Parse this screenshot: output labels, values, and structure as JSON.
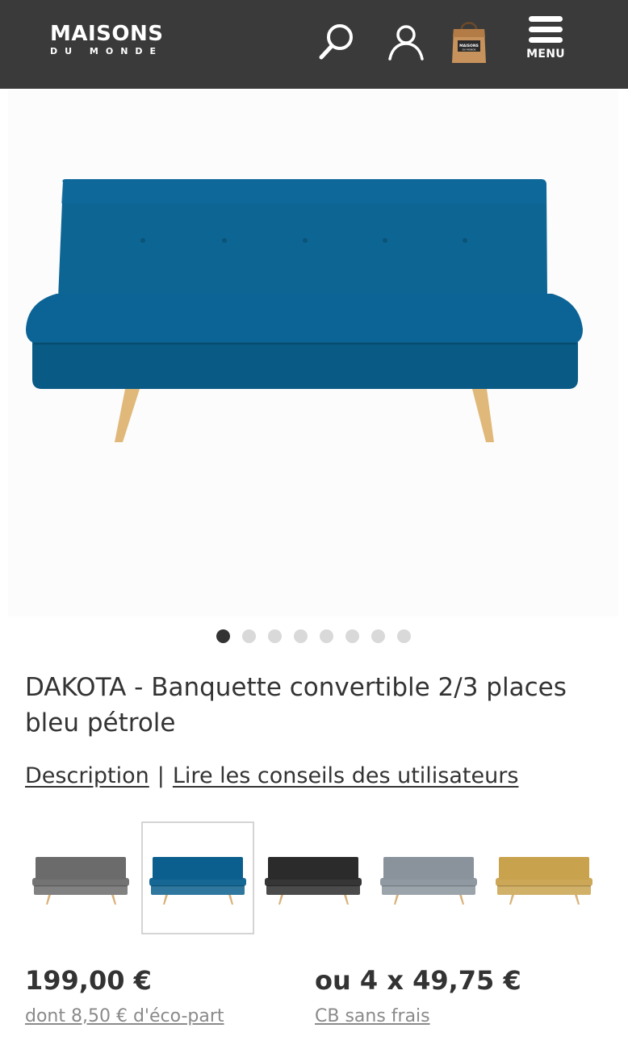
{
  "header": {
    "logo_main": "MAISONS",
    "logo_sub": "DU MONDE",
    "bag_text": "MAISONS DU MONDE",
    "menu_label": "MENU",
    "icons": [
      "search-icon",
      "user-icon",
      "shopping-bag-icon",
      "menu-icon"
    ]
  },
  "gallery": {
    "slide_count": 8,
    "active_index": 0
  },
  "product": {
    "title": "DAKOTA - Banquette convertible 2/3 places bleu pétrole",
    "color_hex": "#0b5f8e"
  },
  "links": {
    "description": "Description",
    "separator": "|",
    "reviews": "Lire les conseils des utilisateurs"
  },
  "variants": [
    {
      "name": "gris",
      "color": "#6b6b6b",
      "selected": false
    },
    {
      "name": "bleu pétrole",
      "color": "#0b5f8e",
      "selected": true
    },
    {
      "name": "noir",
      "color": "#2b2b2b",
      "selected": false
    },
    {
      "name": "gris clair",
      "color": "#8a939c",
      "selected": false
    },
    {
      "name": "jaune moutarde",
      "color": "#c9a24e",
      "selected": false
    }
  ],
  "pricing": {
    "price": "199,00 €",
    "eco_part": "dont 8,50 € d'éco-part",
    "installment": "ou 4 x 49,75 €",
    "installment_note": "CB sans frais"
  }
}
